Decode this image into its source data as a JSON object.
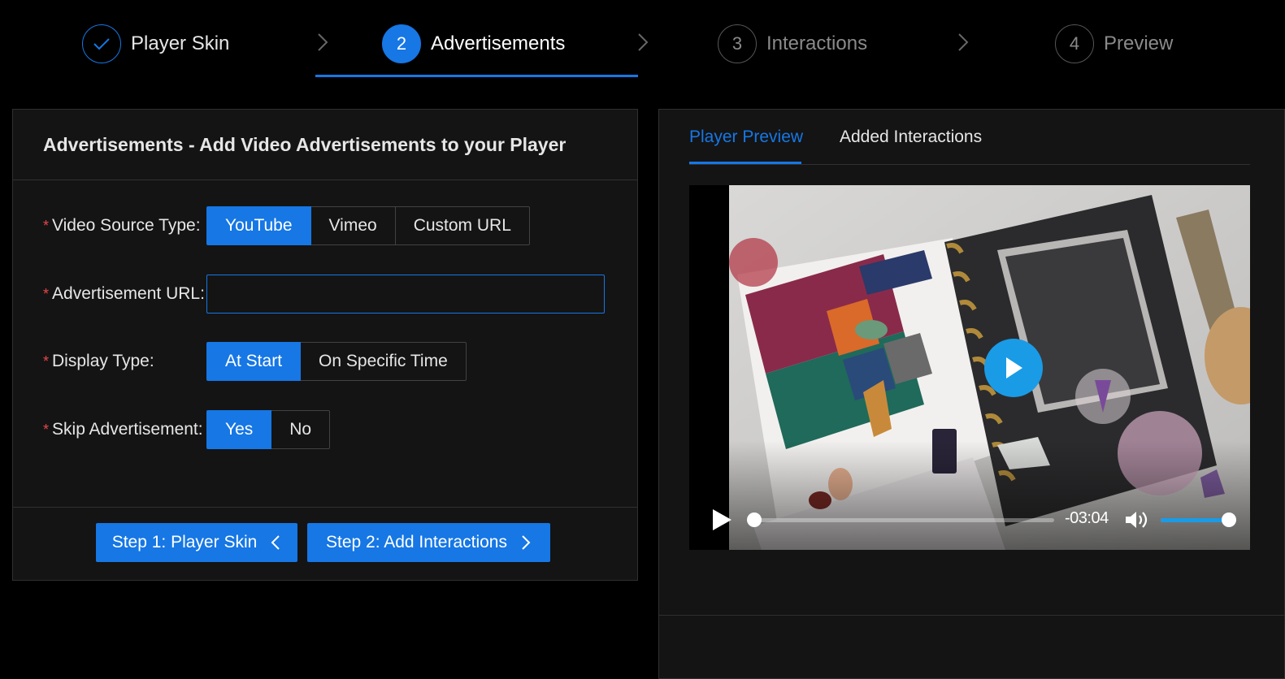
{
  "steps": [
    {
      "number": "",
      "label": "Player Skin",
      "state": "done"
    },
    {
      "number": "2",
      "label": "Advertisements",
      "state": "active"
    },
    {
      "number": "3",
      "label": "Interactions",
      "state": "pending"
    },
    {
      "number": "4",
      "label": "Preview",
      "state": "pending"
    }
  ],
  "form": {
    "title": "Advertisements - Add Video Advertisements to your Player",
    "required_mark": "*",
    "video_source": {
      "label": "Video Source Type",
      "options": [
        "YouTube",
        "Vimeo",
        "Custom URL"
      ],
      "selected": "YouTube"
    },
    "ad_url": {
      "label": "Advertisement URL",
      "value": "",
      "placeholder": ""
    },
    "display_type": {
      "label": "Display Type",
      "options": [
        "At Start",
        "On Specific Time"
      ],
      "selected": "At Start"
    },
    "skip_ad": {
      "label": "Skip Advertisement",
      "options": [
        "Yes",
        "No"
      ],
      "selected": "Yes"
    },
    "prev_button": "Step 1: Player Skin",
    "next_button": "Step 2: Add Interactions"
  },
  "preview": {
    "tabs": [
      "Player Preview",
      "Added Interactions"
    ],
    "active_tab": "Player Preview",
    "player": {
      "time_remaining": "-03:04",
      "progress": 0.0,
      "volume": 1.0,
      "accent_color": "#1a9be6"
    }
  },
  "colors": {
    "primary": "#1677e5",
    "background": "#000000",
    "panel": "#141414",
    "required": "#e84749"
  }
}
